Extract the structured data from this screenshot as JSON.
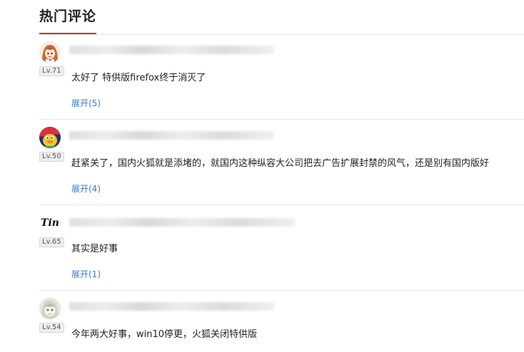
{
  "header": {
    "title": "热门评论"
  },
  "comments": [
    {
      "level": "Lv.71",
      "text": "太好了 特供版firefox终于消灭了",
      "expand": "展开(5)"
    },
    {
      "level": "Lv.50",
      "text": "赶紧关了，国内火狐就是添堵的，就国内这种纵容大公司把去广告扩展封禁的风气，还是别有国内版好",
      "expand": "展开(4)"
    },
    {
      "level": "Lv.65",
      "avatar_text": "Tin",
      "text": "其实是好事",
      "expand": "展开(1)"
    },
    {
      "level": "Lv.54",
      "text": "今年两大好事，win10停更，火狐关闭特供版"
    }
  ],
  "colors": {
    "accent": "#c0392b",
    "link": "#3a7bd5"
  }
}
